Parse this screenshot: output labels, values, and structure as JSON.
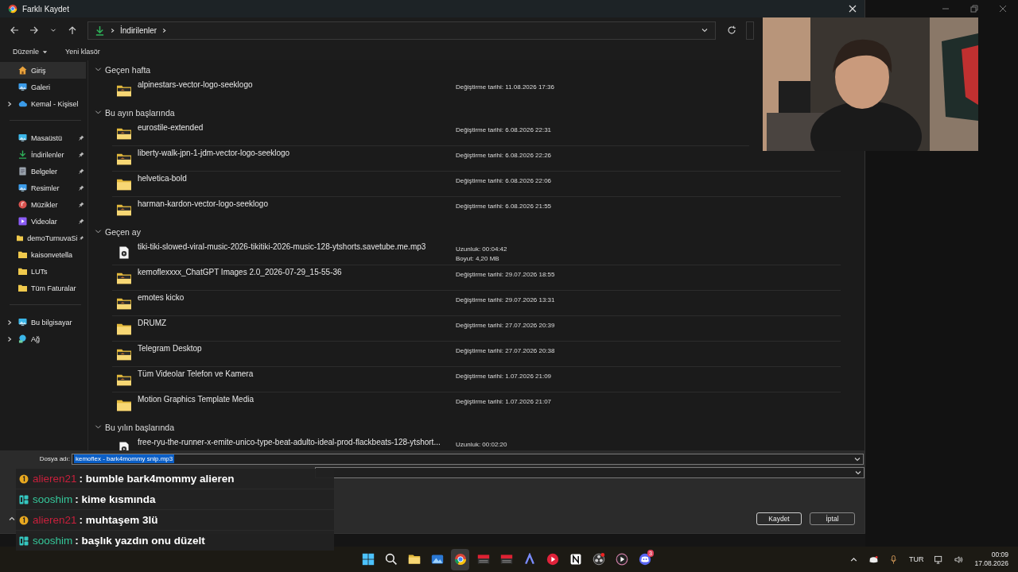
{
  "window": {
    "title": "Farklı Kaydet"
  },
  "address_bar": {
    "path": [
      "İndirilenler"
    ]
  },
  "toolbar": {
    "organize": "Düzenle",
    "new_folder": "Yeni klasör"
  },
  "sidebar": {
    "groups": [
      [
        {
          "label": "Giriş",
          "kind": "home",
          "selected": true,
          "expandable": false,
          "pinned": false
        },
        {
          "label": "Galeri",
          "kind": "gallery",
          "selected": false,
          "expandable": false,
          "pinned": false
        },
        {
          "label": "Kemal - Kişisel",
          "kind": "cloud",
          "selected": false,
          "expandable": true,
          "pinned": false
        }
      ],
      [
        {
          "label": "Masaüstü",
          "kind": "desktop",
          "selected": false,
          "expandable": false,
          "pinned": true
        },
        {
          "label": "İndirilenler",
          "kind": "download",
          "selected": false,
          "expandable": false,
          "pinned": true
        },
        {
          "label": "Belgeler",
          "kind": "document",
          "selected": false,
          "expandable": false,
          "pinned": true
        },
        {
          "label": "Resimler",
          "kind": "pictures",
          "selected": false,
          "expandable": false,
          "pinned": true
        },
        {
          "label": "Müzikler",
          "kind": "music",
          "selected": false,
          "expandable": false,
          "pinned": true
        },
        {
          "label": "Videolar",
          "kind": "video",
          "selected": false,
          "expandable": false,
          "pinned": true
        },
        {
          "label": "demoTurnuvaSi",
          "kind": "folder",
          "selected": false,
          "expandable": false,
          "pinned": true
        },
        {
          "label": "kaisonvetella",
          "kind": "folder",
          "selected": false,
          "expandable": false,
          "pinned": false
        },
        {
          "label": "LUTs",
          "kind": "folder",
          "selected": false,
          "expandable": false,
          "pinned": false
        },
        {
          "label": "Tüm Faturalar",
          "kind": "folder",
          "selected": false,
          "expandable": false,
          "pinned": false
        }
      ],
      [
        {
          "label": "Bu bilgisayar",
          "kind": "computer",
          "selected": false,
          "expandable": true,
          "pinned": false
        },
        {
          "label": "Ağ",
          "kind": "network",
          "selected": false,
          "expandable": true,
          "pinned": false
        }
      ]
    ]
  },
  "groups": [
    {
      "title": "Geçen hafta",
      "items": [
        {
          "name": "alpinestars-vector-logo-seeklogo",
          "kind": "folder-preview",
          "details": [
            "Değiştirme tarihi: 11.08.2026 17:36"
          ]
        }
      ]
    },
    {
      "title": "Bu ayın başlarında",
      "items": [
        {
          "name": "eurostile-extended",
          "kind": "folder-preview",
          "details": [
            "Değiştirme tarihi: 6.08.2026 22:31"
          ]
        },
        {
          "name": "liberty-walk-jpn-1-jdm-vector-logo-seeklogo",
          "kind": "folder-preview",
          "details": [
            "Değiştirme tarihi: 6.08.2026 22:26"
          ]
        },
        {
          "name": "helvetica-bold",
          "kind": "folder",
          "details": [
            "Değiştirme tarihi: 6.08.2026 22:06"
          ]
        },
        {
          "name": "harman-kardon-vector-logo-seeklogo",
          "kind": "folder-preview",
          "details": [
            "Değiştirme tarihi: 6.08.2026 21:55"
          ]
        }
      ]
    },
    {
      "title": "Geçen ay",
      "items": [
        {
          "name": "tiki-tiki-slowed-viral-music-2026-tikitiki-2026-music-128-ytshorts.savetube.me.mp3",
          "kind": "audio",
          "details": [
            "Uzunluk: 00:04:42",
            "Boyut: 4,20 MB"
          ]
        },
        {
          "name": "kemoflexxxx_ChatGPT Images 2.0_2026-07-29_15-55-36",
          "kind": "folder-preview",
          "details": [
            "Değiştirme tarihi: 29.07.2026 18:55"
          ]
        },
        {
          "name": "emotes kicko",
          "kind": "folder-preview",
          "details": [
            "Değiştirme tarihi: 29.07.2026 13:31"
          ]
        },
        {
          "name": "DRUMZ",
          "kind": "folder",
          "details": [
            "Değiştirme tarihi: 27.07.2026 20:39"
          ]
        },
        {
          "name": "Telegram Desktop",
          "kind": "folder-preview",
          "details": [
            "Değiştirme tarihi: 27.07.2026 20:38"
          ]
        },
        {
          "name": "Tüm Videolar Telefon ve Kamera",
          "kind": "folder-preview",
          "details": [
            "Değiştirme tarihi: 1.07.2026 21:09"
          ]
        },
        {
          "name": "Motion Graphics Template Media",
          "kind": "folder",
          "details": [
            "Değiştirme tarihi: 1.07.2026 21:07"
          ]
        }
      ]
    },
    {
      "title": "Bu yılın başlarında",
      "items": [
        {
          "name": "free-ryu-the-runner-x-emite-unico-type-beat-adulto-ideal-prod-flackbeats-128-ytshort...",
          "kind": "audio",
          "details": [
            "Uzunluk: 00:02:20"
          ]
        }
      ]
    }
  ],
  "save_form": {
    "file_name_label": "Dosya adı:",
    "file_name": "kemoflex - bark4mommy snip.mp3",
    "save": "Kaydet",
    "cancel": "İptal"
  },
  "chat": [
    {
      "kind": "sub",
      "user": "alieren21",
      "color": "#c8203c",
      "text": ": bumble bark4mommy alieren"
    },
    {
      "kind": "app",
      "user": "sooshim",
      "color": "#35c79a",
      "text": ": kime kısmında"
    },
    {
      "kind": "sub",
      "user": "alieren21",
      "color": "#c8203c",
      "text": ": muhtaşem 3lü"
    },
    {
      "kind": "app",
      "user": "sooshim",
      "color": "#35c79a",
      "text": ": başlık yazdın onu düzelt"
    }
  ],
  "taskbar": {
    "apps": [
      {
        "kind": "start",
        "selected": false
      },
      {
        "kind": "search",
        "selected": false
      },
      {
        "kind": "files",
        "selected": false
      },
      {
        "kind": "photos",
        "selected": false
      },
      {
        "kind": "browser",
        "selected": true
      },
      {
        "kind": "mixer",
        "selected": false
      },
      {
        "kind": "mixer",
        "selected": false
      },
      {
        "kind": "arc",
        "selected": false
      },
      {
        "kind": "play",
        "selected": false
      },
      {
        "kind": "notes",
        "selected": false
      },
      {
        "kind": "obs",
        "selected": false
      },
      {
        "kind": "player",
        "selected": false
      },
      {
        "kind": "chat",
        "selected": false,
        "badge": "3"
      }
    ],
    "language": "TUR",
    "time": "00:09",
    "date": "17.08.2026"
  }
}
